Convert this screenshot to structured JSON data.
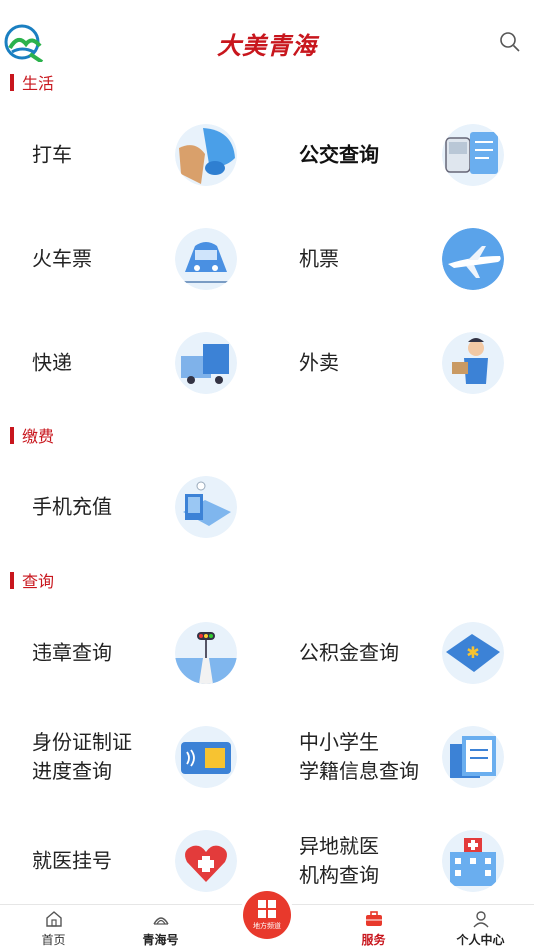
{
  "header": {
    "brand": "大美青海",
    "logo_icon": "qinghai-logo-icon",
    "search_icon": "search-icon"
  },
  "sections": [
    {
      "title": "生活"
    },
    {
      "title": "缴费"
    },
    {
      "title": "查询"
    }
  ],
  "tiles": {
    "taxi": "打车",
    "bus": "公交查询",
    "train": "火车票",
    "flight": "机票",
    "express": "快递",
    "takeout": "外卖",
    "recharge": "手机充值",
    "violation": "违章查询",
    "fund": "公积金查询",
    "idcard": "身份证制证\n进度查询",
    "student": "中小学生\n学籍信息查询",
    "hospital": "就医挂号",
    "remote_med": "异地就医\n机构查询"
  },
  "tabbar": {
    "home": "首页",
    "qinghai": "青海号",
    "center": "地方频道",
    "service": "服务",
    "profile": "个人中心"
  },
  "colors": {
    "accent": "#c8161d",
    "fab": "#e8392c",
    "icon_blue": "#4a90e2"
  }
}
